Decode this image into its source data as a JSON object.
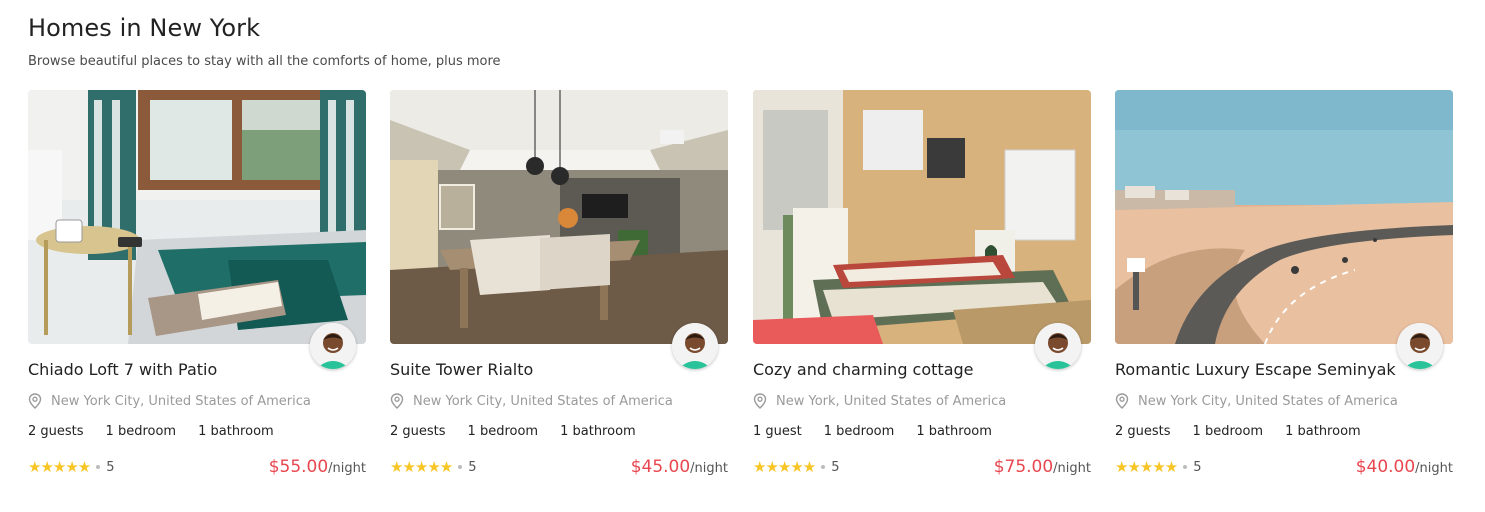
{
  "section": {
    "title": "Homes in New York",
    "subtitle": "Browse beautiful places to stay with all the comforts of home, plus more"
  },
  "icons": {
    "location": "map-pin-icon",
    "rating": "star-icon",
    "avatar": "host-avatar"
  },
  "colors": {
    "price": "#e8474f",
    "stars": "#f7c626",
    "muted": "#9a9a9a"
  },
  "cards": [
    {
      "title": "Chiado Loft 7 with Patio",
      "location": "New York City, United States of America",
      "guests": "2 guests",
      "bedrooms": "1 bedroom",
      "bathrooms": "1 bathroom",
      "stars": "★★★★★",
      "rating": "5",
      "price": "$55.00",
      "unit": "/night"
    },
    {
      "title": "Suite Tower Rialto",
      "location": "New York City, United States of America",
      "guests": "2 guests",
      "bedrooms": "1 bedroom",
      "bathrooms": "1 bathroom",
      "stars": "★★★★★",
      "rating": "5",
      "price": "$45.00",
      "unit": "/night"
    },
    {
      "title": "Cozy and charming cottage",
      "location": "New York, United States of America",
      "guests": "1 guest",
      "bedrooms": "1 bedroom",
      "bathrooms": "1 bathroom",
      "stars": "★★★★★",
      "rating": "5",
      "price": "$75.00",
      "unit": "/night"
    },
    {
      "title": "Romantic Luxury Escape Seminyak",
      "location": "New York City, United States of America",
      "guests": "2 guests",
      "bedrooms": "1 bedroom",
      "bathrooms": "1 bathroom",
      "stars": "★★★★★",
      "rating": "5",
      "price": "$40.00",
      "unit": "/night"
    }
  ]
}
